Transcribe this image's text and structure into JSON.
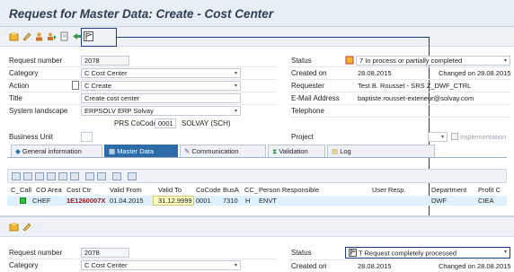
{
  "title": "Request for Master Data: Create - Cost Center",
  "top_form": {
    "request_number_label": "Request number",
    "request_number": "2078",
    "category_label": "Category",
    "category": "C Cost Center",
    "action_label": "Action",
    "action": "C Create",
    "title_label": "Title",
    "title_value": "Create cost center",
    "system_landscape_label": "System landscape",
    "system_landscape": "ERPSOLV ERP Solvay",
    "prs_cocode_label": "PRS CoCode",
    "prs_cocode": "0001",
    "prs_cocode_text": "SOLVAY (SCH)",
    "business_unit_label": "Business Unit",
    "status_label": "Status",
    "status": "7 In process or partially completed",
    "created_on_label": "Created on",
    "created_on": "28.08.2015",
    "changed_on": "Changed on 28.08.2015",
    "requester_label": "Requester",
    "requester": "Test B. Rousset - SRS Z_DWF_CTRL",
    "email_label": "E-Mail Address",
    "email": "baptiste.rousset-exterieur@solvay.com",
    "telephone_label": "Telephone",
    "project_label": "Project",
    "implementation_label": "Implementation"
  },
  "tabs": [
    {
      "label": "General information"
    },
    {
      "label": "Master Data"
    },
    {
      "label": "Communication"
    },
    {
      "label": "Validation"
    },
    {
      "label": "Log"
    }
  ],
  "table": {
    "headers": [
      "C_",
      "Call",
      "CO Area",
      "Cost Ctr",
      "Valid From",
      "Valid To",
      "CoCode",
      "BusA",
      "CC_",
      "Person Responsible",
      "User Resp.",
      "Department",
      "Profit C"
    ],
    "row": {
      "call": "CHEF",
      "cost_ctr": "1E1260007X",
      "valid_from": "01.04.2015",
      "valid_to": "31.12.9999",
      "cocode": "0001",
      "busa": "7310",
      "cc": "H",
      "person": "ENVT",
      "department": "DWF",
      "profit": "CIEA"
    }
  },
  "bottom_form": {
    "request_number_label": "Request number",
    "request_number": "2078",
    "category_label": "Category",
    "category": "C Cost Center",
    "status_label": "Status",
    "status": "T Request completely processed",
    "created_on_label": "Created on",
    "created_on": "28.08.2015",
    "changed_on": "Changed on 28.08.2015"
  },
  "colors": {
    "accent": "#1a3a8a",
    "tab_active": "#2d6ca8",
    "row_highlight": "#dff0ff"
  }
}
